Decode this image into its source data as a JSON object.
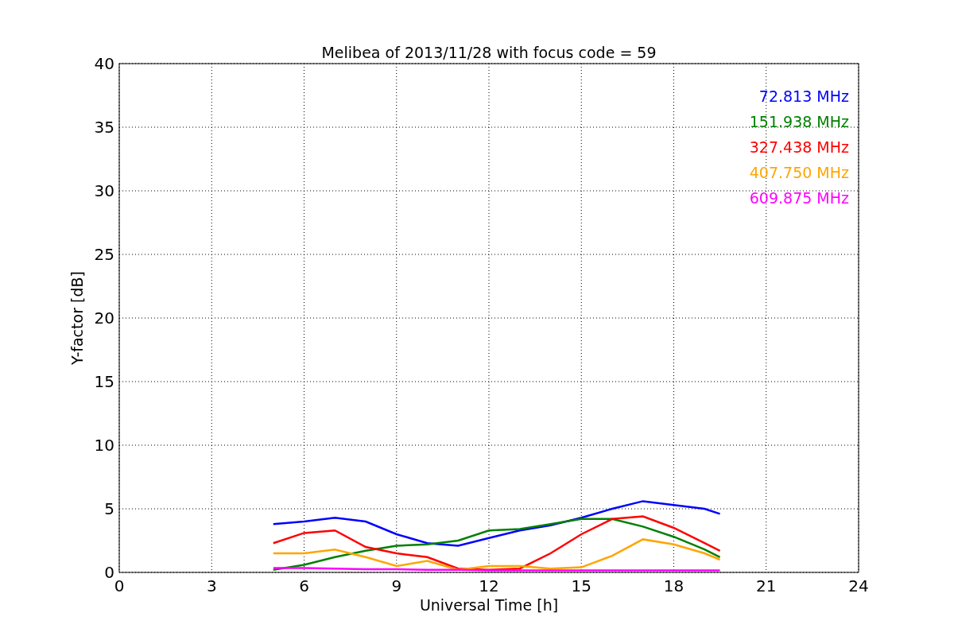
{
  "chart": {
    "chart_data": {
      "type": "line",
      "title": "Melibea of 2013/11/28 with focus code = 59",
      "xlabel": "Universal Time [h]",
      "ylabel": "Y-factor [dB]",
      "x": [
        5,
        6,
        7,
        8,
        9,
        10,
        11,
        12,
        13,
        14,
        15,
        16,
        17,
        18,
        19,
        19.5
      ],
      "series": [
        {
          "name": "72.813 MHz",
          "color": "#0000ff",
          "values": [
            3.8,
            4.0,
            4.3,
            4.0,
            3.0,
            2.3,
            2.1,
            2.7,
            3.3,
            3.7,
            4.3,
            5.0,
            5.6,
            5.3,
            5.0,
            4.6
          ]
        },
        {
          "name": "151.938 MHz",
          "color": "#008000",
          "values": [
            0.2,
            0.6,
            1.2,
            1.7,
            2.1,
            2.2,
            2.5,
            3.3,
            3.4,
            3.8,
            4.2,
            4.2,
            3.6,
            2.8,
            1.8,
            1.2
          ]
        },
        {
          "name": "327.438 MHz",
          "color": "#ff0000",
          "values": [
            2.3,
            3.1,
            3.3,
            2.0,
            1.5,
            1.2,
            0.3,
            0.2,
            0.3,
            1.5,
            3.0,
            4.2,
            4.4,
            3.5,
            2.3,
            1.7
          ]
        },
        {
          "name": "407.750 MHz",
          "color": "#ffa500",
          "values": [
            1.5,
            1.5,
            1.8,
            1.2,
            0.5,
            0.9,
            0.2,
            0.5,
            0.5,
            0.3,
            0.4,
            1.3,
            2.6,
            2.2,
            1.5,
            1.0
          ]
        },
        {
          "name": "609.875 MHz",
          "color": "#ff00ff",
          "values": [
            0.35,
            0.35,
            0.3,
            0.25,
            0.25,
            0.2,
            0.2,
            0.15,
            0.15,
            0.15,
            0.15,
            0.15,
            0.15,
            0.15,
            0.15,
            0.15
          ]
        }
      ],
      "grid": true,
      "xlim": [
        0,
        24
      ],
      "ylim": [
        0,
        40
      ],
      "xticks": [
        0,
        3,
        6,
        9,
        12,
        15,
        18,
        21,
        24
      ],
      "yticks": [
        0,
        5,
        10,
        15,
        20,
        25,
        30,
        35,
        40
      ]
    }
  }
}
